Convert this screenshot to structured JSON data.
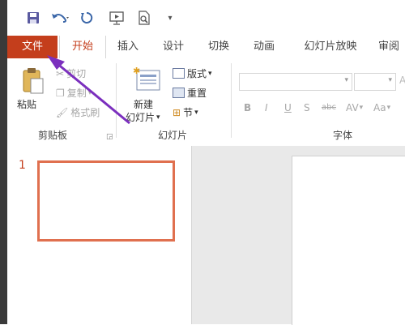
{
  "quick_access": {
    "icons": [
      "save-icon",
      "undo-icon",
      "redo-icon",
      "slideshow-from-start-icon",
      "print-preview-icon",
      "customize-qat-icon"
    ],
    "overflow_glyph": "▾"
  },
  "tabs": [
    "文件",
    "开始",
    "插入",
    "设计",
    "切换",
    "动画",
    "幻灯片放映",
    "审阅"
  ],
  "ribbon": {
    "clipboard": {
      "paste_label": "粘贴",
      "cut_label": "剪切",
      "copy_label": "复制",
      "format_painter_label": "格式刷",
      "group_label": "剪贴板"
    },
    "slides": {
      "new_slide_line1": "新建",
      "new_slide_line2": "幻灯片",
      "layout_label": "版式",
      "reset_label": "重置",
      "section_label": "节",
      "group_label": "幻灯片"
    },
    "font": {
      "bold": "B",
      "italic": "I",
      "underline": "U",
      "shadow": "S",
      "strikethrough": "abc",
      "char_spacing": "AV",
      "change_case": "Aa",
      "group_label": "字体"
    }
  },
  "thumbnail_pane": {
    "slide_number": "1"
  },
  "colors": {
    "accent": "#c43e1c",
    "annotation_arrow": "#7b2fbe"
  }
}
